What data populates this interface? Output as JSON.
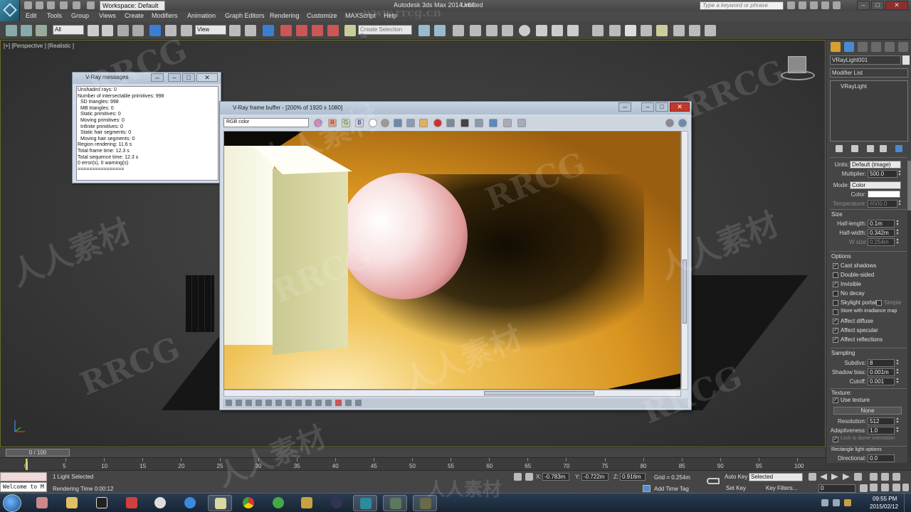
{
  "titlebar": {
    "workspace": "Workspace: Default",
    "app_title": "Autodesk 3ds Max  2014 x64",
    "doc_title": "Untitled",
    "search_placeholder": "Type a keyword or phrase"
  },
  "menu": [
    "Edit",
    "Tools",
    "Group",
    "Views",
    "Create",
    "Modifiers",
    "Animation",
    "Graph Editors",
    "Rendering",
    "Customize",
    "MAXScript",
    "Help"
  ],
  "toolbar": {
    "selection_filter": "All",
    "reference_coord": "View",
    "named_selection_placeholder": "Create Selection Se"
  },
  "viewport": {
    "label": "[+] [Perspective ] [Realistic ]"
  },
  "vray_messages": {
    "title": "V-Ray messages",
    "lines": [
      "Unshaded rays: 0",
      "Number of intersectable primitives: 998",
      "SD triangles: 998",
      "MB triangles: 0",
      "Static primitives: 0",
      "Moving primitives: 0",
      "Infinite primitives: 0",
      "Static hair segments: 0",
      "Moving hair segments: 0",
      "Region rendering: 11.6 s",
      "Total frame time: 12.3 s",
      "Total sequence time: 12.3 s",
      "0 error(s), 0 warning(s)",
      "================"
    ]
  },
  "vfb": {
    "title": "V-Ray frame buffer - [200% of 1920 x 1080]",
    "channel": "RGB color",
    "r_label": "R",
    "g_label": "G",
    "b_label": "B"
  },
  "cmdpanel": {
    "object_name": "VRayLight001",
    "modifier_list": "Modifier List",
    "stack_entry": "VRayLight",
    "units_label": "Units:",
    "units_value": "Default (image)",
    "multiplier_label": "Multiplier:",
    "multiplier_value": "500.0",
    "mode_label": "Mode:",
    "mode_value": "Color",
    "color_label": "Color:",
    "temperature_label": "Temperature:",
    "temperature_value": "6500.0",
    "size_section": "Size",
    "half_length_label": "Half-length:",
    "half_length_value": "0.1m",
    "half_width_label": "Half-width:",
    "half_width_value": "0.342m",
    "w_size_label": "W size",
    "w_size_value": "0.254m",
    "options_section": "Options",
    "cast_shadows": "Cast shadows",
    "double_sided": "Double-sided",
    "invisible": "Invisible",
    "no_decay": "No decay",
    "skylight_portal": "Skylight portal",
    "simple": "Simple",
    "store_irradiance": "Store with irradiance map",
    "affect_diffuse": "Affect diffuse",
    "affect_specular": "Affect specular",
    "affect_reflections": "Affect reflections",
    "sampling_section": "Sampling",
    "subdivs_label": "Subdivs:",
    "subdivs_value": "8",
    "shadow_bias_label": "Shadow bias:",
    "shadow_bias_value": "0.001m",
    "cutoff_label": "Cutoff:",
    "cutoff_value": "0.001",
    "texture_section": "Texture:",
    "use_texture": "Use texture",
    "texture_none": "None",
    "resolution_label": "Resolution:",
    "resolution_value": "512",
    "adaptiveness_label": "Adaptiveness:",
    "adaptiveness_value": "1.0",
    "lock_to_dome": "Lock to dome orientation",
    "rect_options_section": "Rectangle light options",
    "directional_label": "Directional:",
    "directional_value": "0.0"
  },
  "timeline": {
    "frame_range": "0 / 100",
    "ticks": [
      "0",
      "5",
      "10",
      "15",
      "20",
      "25",
      "30",
      "35",
      "40",
      "45",
      "50",
      "55",
      "60",
      "65",
      "70",
      "75",
      "80",
      "85",
      "90",
      "95",
      "100"
    ]
  },
  "status": {
    "maxscript_output": "Welcome to M",
    "selection": "1 Light Selected",
    "render_time": "Rendering Time  0:00:12",
    "x_label": "X:",
    "x_value": "-0.783m",
    "y_label": "Y:",
    "y_value": "-0.722m",
    "z_label": "Z:",
    "z_value": "0.916m",
    "grid": "Grid = 0.254m",
    "add_time_tag": "Add Time Tag",
    "auto_key": "Auto Key",
    "set_key": "Set Key",
    "selected_dd": "Selected",
    "key_filters": "Key Filters...",
    "frame_value": "0"
  },
  "taskbar": {
    "time": "09:55 PM",
    "date": "2015/02/12"
  },
  "watermark": {
    "latin": "RRCG",
    "chinese": "人人素材",
    "url": "www.rrcg.cn"
  }
}
